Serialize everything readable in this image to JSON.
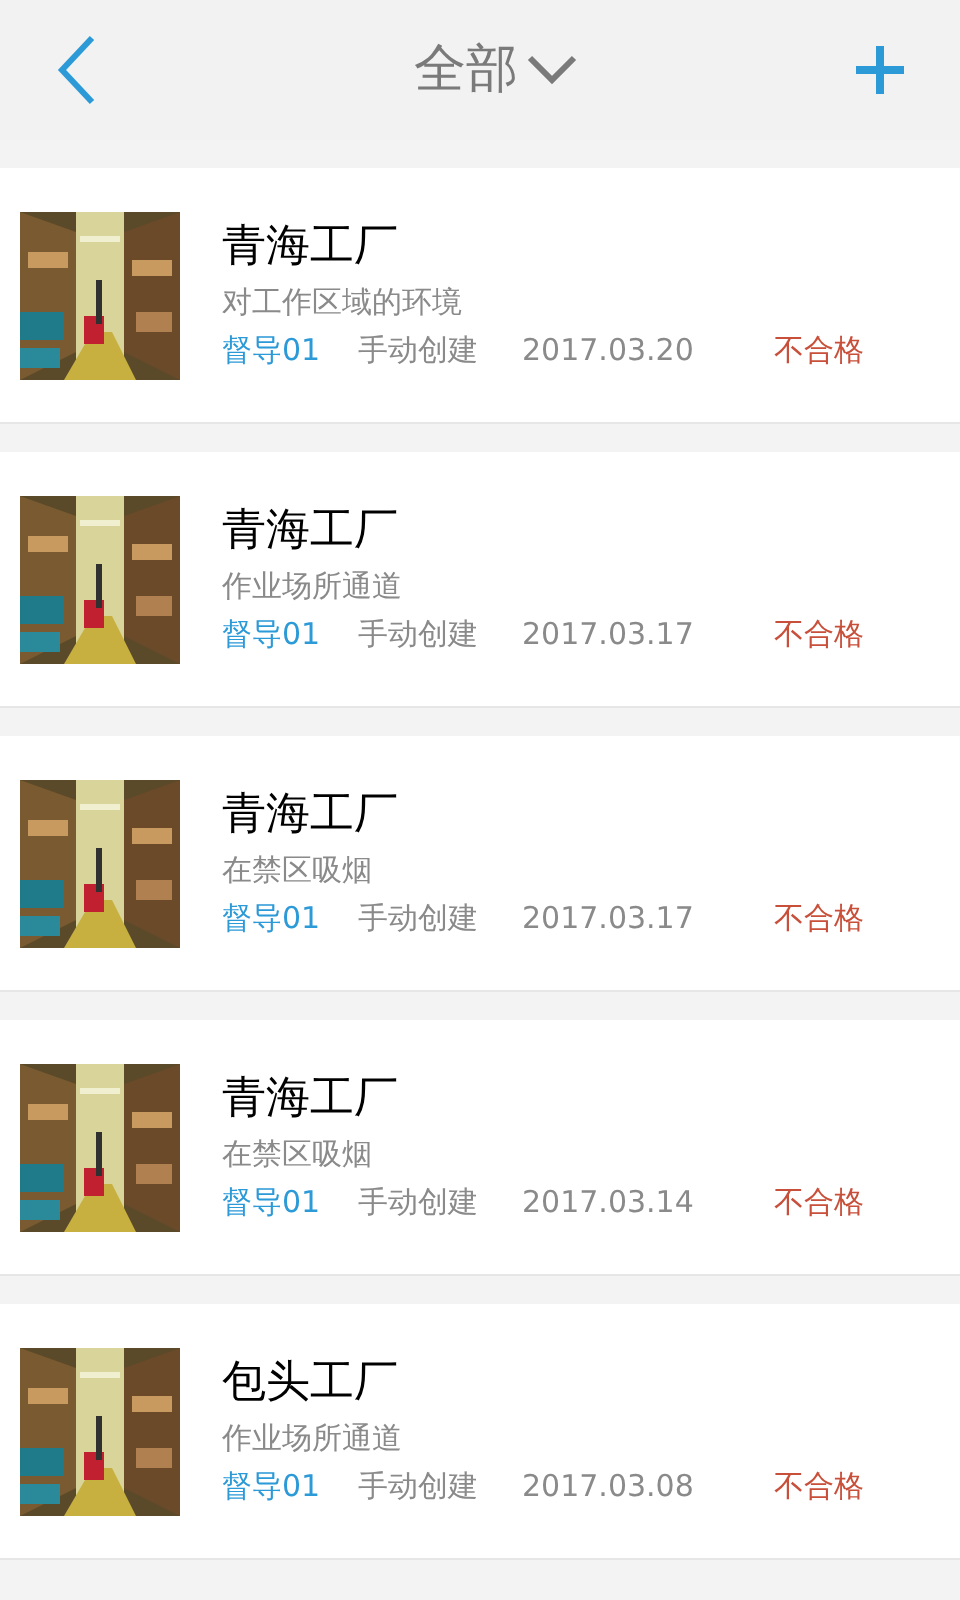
{
  "header": {
    "title": "全部"
  },
  "items": [
    {
      "title": "青海工厂",
      "subtitle": "对工作区域的环境",
      "supervisor": "督导01",
      "source": "手动创建",
      "date": "2017.03.20",
      "status": "不合格"
    },
    {
      "title": "青海工厂",
      "subtitle": "作业场所通道",
      "supervisor": "督导01",
      "source": "手动创建",
      "date": "2017.03.17",
      "status": "不合格"
    },
    {
      "title": "青海工厂",
      "subtitle": "在禁区吸烟",
      "supervisor": "督导01",
      "source": "手动创建",
      "date": "2017.03.17",
      "status": "不合格"
    },
    {
      "title": "青海工厂",
      "subtitle": "在禁区吸烟",
      "supervisor": "督导01",
      "source": "手动创建",
      "date": "2017.03.14",
      "status": "不合格"
    },
    {
      "title": "包头工厂",
      "subtitle": "作业场所通道",
      "supervisor": "督导01",
      "source": "手动创建",
      "date": "2017.03.08",
      "status": "不合格"
    }
  ]
}
